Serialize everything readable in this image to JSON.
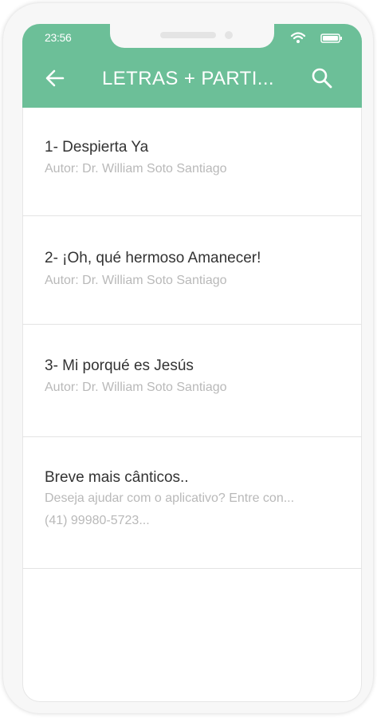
{
  "status_bar": {
    "time": "23:56",
    "icons": [
      "wifi-icon",
      "battery-icon"
    ]
  },
  "app_bar": {
    "title": "LETRAS + PARTI...",
    "back_icon": "arrow-left-icon",
    "search_icon": "search-icon",
    "color": "#6cbf98"
  },
  "songs": [
    {
      "title": "1- Despierta Ya",
      "subtitle": "Autor: Dr. William Soto Santiago"
    },
    {
      "title": "2- ¡Oh, qué hermoso Amanecer!",
      "subtitle": "Autor: Dr. William Soto Santiago"
    },
    {
      "title": "3- Mi porqué es Jesús",
      "subtitle": "Autor: Dr. William Soto Santiago"
    }
  ],
  "notice": {
    "title": "Breve mais cânticos..",
    "line1": "Deseja ajudar com o aplicativo? Entre con...",
    "line2": "(41) 99980-5723..."
  }
}
